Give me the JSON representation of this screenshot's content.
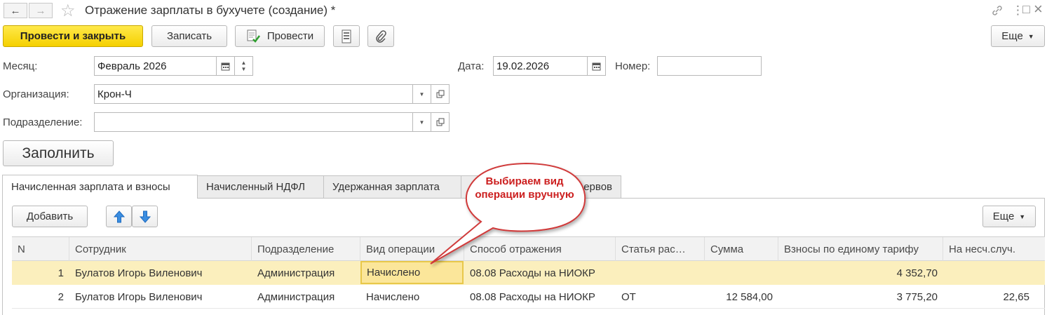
{
  "window": {
    "title": "Отражение зарплаты в бухучете (создание) *",
    "back_icon": "←",
    "forward_icon": "→",
    "star_icon": "☆",
    "link_icon": "🔗",
    "menu_icon": "⋮",
    "restore_icon": "□",
    "close_icon": "×"
  },
  "toolbar": {
    "post_close": "Провести и закрыть",
    "save": "Записать",
    "post": "Провести",
    "more": "Еще"
  },
  "form": {
    "month_label": "Месяц:",
    "month_value": "Февраль 2026",
    "date_label": "Дата:",
    "date_value": "19.02.2026",
    "number_label": "Номер:",
    "number_value": "",
    "org_label": "Организация:",
    "org_value": "Крон-Ч",
    "dept_label": "Подразделение:",
    "dept_value": "",
    "fill_button": "Заполнить"
  },
  "tabs": [
    {
      "label": "Начисленная зарплата и взносы",
      "active": true
    },
    {
      "label": "Начисленный НДФЛ",
      "active": false
    },
    {
      "label": "Удержанная зарплата",
      "active": false
    },
    {
      "label": "ервов",
      "active": false
    }
  ],
  "table_toolbar": {
    "add": "Добавить",
    "more": "Еще"
  },
  "table": {
    "columns": [
      "N",
      "Сотрудник",
      "Подразделение",
      "Вид операции",
      "Способ отражения",
      "Статья рас…",
      "Сумма",
      "Взносы по единому тарифу",
      "На несч.случ."
    ],
    "rows": [
      {
        "n": "1",
        "employee": "Булатов Игорь Виленович",
        "dept": "Администрация",
        "op": "Начислено",
        "method": "08.08 Расходы на НИОКР",
        "article": "",
        "sum": "",
        "contrib": "4 352,70",
        "accident": ""
      },
      {
        "n": "2",
        "employee": "Булатов Игорь Виленович",
        "dept": "Администрация",
        "op": "Начислено",
        "method": "08.08 Расходы на НИОКР",
        "article": "ОТ",
        "sum": "12 584,00",
        "contrib": "3 775,20",
        "accident": "22,65"
      }
    ]
  },
  "callout": {
    "text": "Выбираем вид операции вручную",
    "color": "#cc1f1f"
  },
  "colors": {
    "primary_button": "#f5d000",
    "selected_row": "#fbefbd",
    "header_bg": "#f2f2f2"
  }
}
